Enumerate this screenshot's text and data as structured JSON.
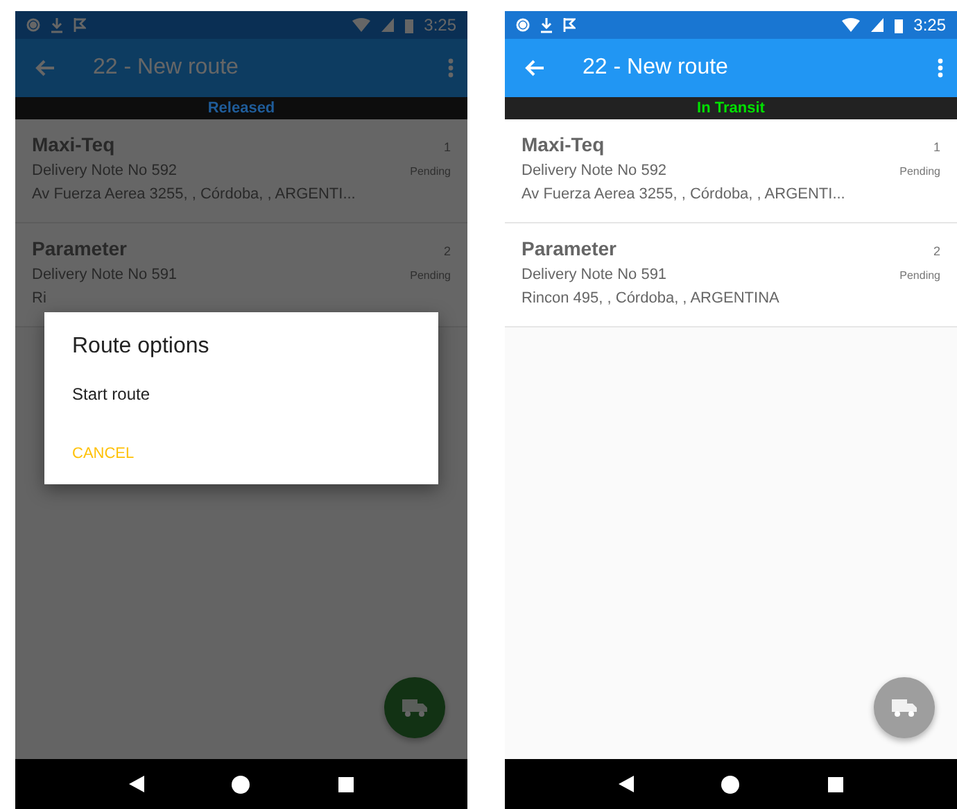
{
  "phones": [
    {
      "status_bar": {
        "time": "3:25"
      },
      "app_bar": {
        "title": "22 - New route"
      },
      "route_status": {
        "label": "Released",
        "color": "#1f5c99"
      },
      "stops": [
        {
          "name": "Maxi-Teq",
          "number": "1",
          "note": "Delivery Note No 592",
          "status": "Pending",
          "address": "Av Fuerza Aerea 3255, , Córdoba, , ARGENTI..."
        },
        {
          "name": "Parameter",
          "number": "2",
          "note": "Delivery Note No 591",
          "status": "Pending",
          "address": "Ri"
        }
      ],
      "fab": {
        "active": true
      },
      "dialog": {
        "title": "Route options",
        "options": [
          "Start route"
        ],
        "cancel": "CANCEL"
      }
    },
    {
      "status_bar": {
        "time": "3:25"
      },
      "app_bar": {
        "title": "22 - New route"
      },
      "route_status": {
        "label": "In Transit",
        "color": "#00e000"
      },
      "stops": [
        {
          "name": "Maxi-Teq",
          "number": "1",
          "note": "Delivery Note No 592",
          "status": "Pending",
          "address": "Av Fuerza Aerea 3255, , Córdoba, , ARGENTI..."
        },
        {
          "name": "Parameter",
          "number": "2",
          "note": "Delivery Note No 591",
          "status": "Pending",
          "address": "Rincon 495, , Córdoba, , ARGENTINA"
        }
      ],
      "fab": {
        "active": false
      }
    }
  ]
}
